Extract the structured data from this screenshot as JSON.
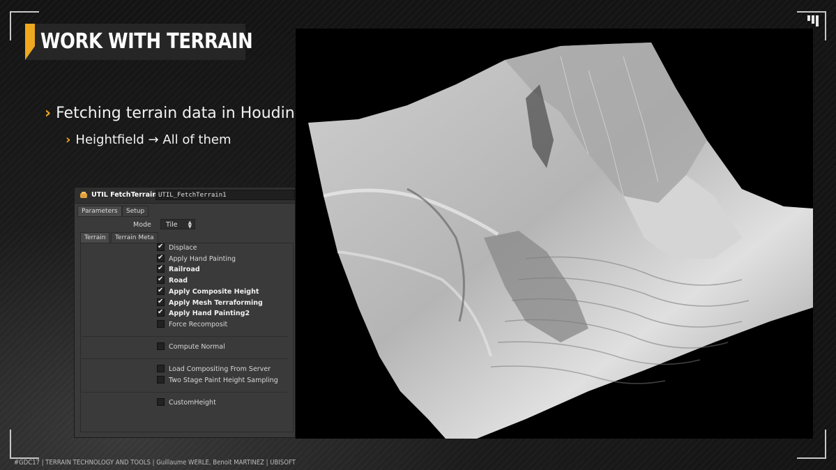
{
  "slide": {
    "title": "WORK WITH TERRAIN",
    "bullet1": "Fetching terrain data in Houdini",
    "bullet2_a": "Heightfield",
    "bullet2_arrow": "→",
    "bullet2_b": "All of them",
    "footer": "#GDC17 | TERRAIN TECHNOLOGY AND TOOLS | Guillaume WERLE, Benoit MARTINEZ | UBISOFT",
    "accent_color": "#f0a81e"
  },
  "panel": {
    "node_type": "UTIL FetchTerrain",
    "node_name": "UTIL_FetchTerrain1",
    "tabs": [
      "Parameters",
      "Setup"
    ],
    "mode_label": "Mode",
    "mode_value": "Tile",
    "sub_tabs": [
      "Terrain",
      "Terrain Meta"
    ],
    "params": [
      {
        "label": "Displace",
        "checked": true,
        "bold": false
      },
      {
        "label": "Apply Hand Painting",
        "checked": true,
        "bold": false
      },
      {
        "label": "Railroad",
        "checked": true,
        "bold": true
      },
      {
        "label": "Road",
        "checked": true,
        "bold": true
      },
      {
        "label": "Apply Composite Height",
        "checked": true,
        "bold": true
      },
      {
        "label": "Apply Mesh Terraforming",
        "checked": true,
        "bold": true
      },
      {
        "label": "Apply Hand Painting2",
        "checked": true,
        "bold": true
      },
      {
        "label": "Force Recomposit",
        "checked": false,
        "bold": false
      },
      {
        "label": "Compute Normal",
        "checked": false,
        "bold": false
      },
      {
        "label": "Load Compositing From Server",
        "checked": false,
        "bold": false
      },
      {
        "label": "Two Stage Paint Height Sampling",
        "checked": false,
        "bold": false
      },
      {
        "label": "CustomHeight",
        "checked": false,
        "bold": false
      }
    ]
  },
  "render": {
    "icon": "terrain-heightfield-render"
  }
}
